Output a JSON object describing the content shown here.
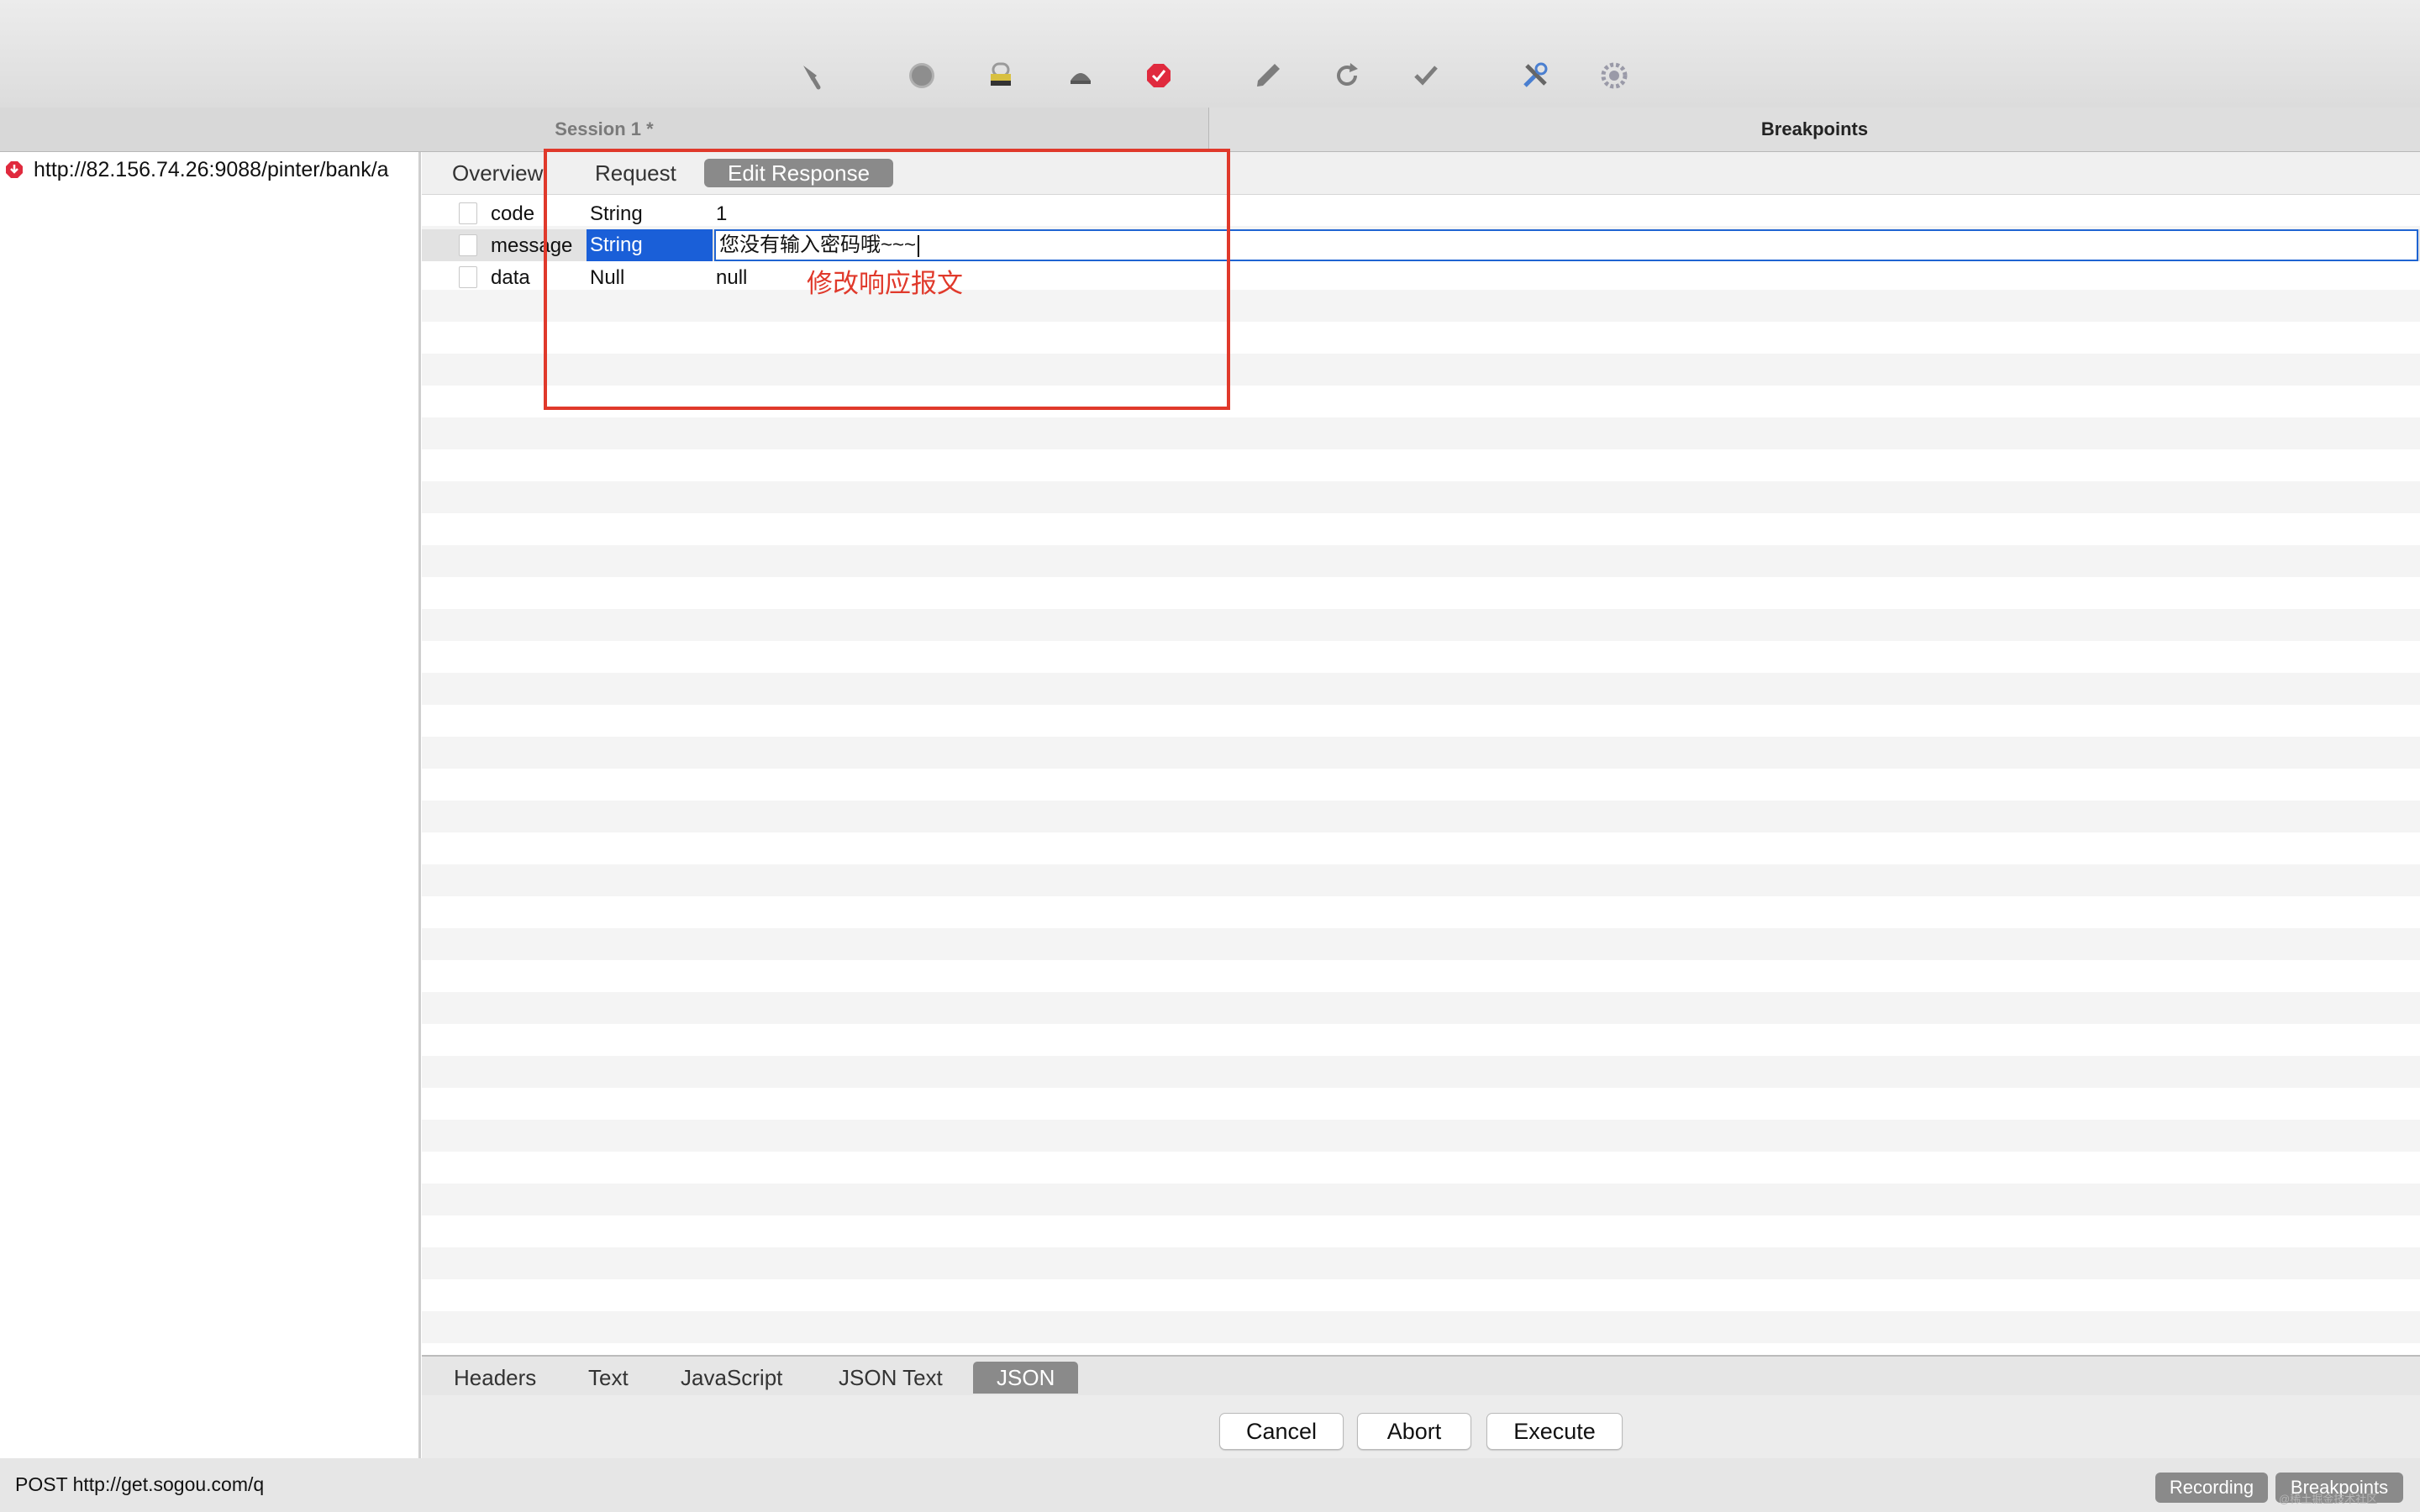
{
  "toolbar": {
    "icons": [
      "broom-icon",
      "record-icon",
      "ssl-lock-icon",
      "throttle-turtle-icon",
      "breakpoint-icon",
      "compose-pen-icon",
      "repeat-icon",
      "validate-check-icon",
      "tools-icon",
      "settings-gear-icon"
    ]
  },
  "session": {
    "tab_title": "Session 1 *",
    "breakpoints_title": "Breakpoints"
  },
  "left": {
    "request_url": "http://82.156.74.26:9088/pinter/bank/a"
  },
  "subtabs": {
    "overview": "Overview",
    "request": "Request",
    "edit_response": "Edit Response"
  },
  "json_rows": [
    {
      "key": "code",
      "type": "String",
      "value": "1"
    },
    {
      "key": "message",
      "type": "String",
      "value": "您没有输入密码哦~~~"
    },
    {
      "key": "data",
      "type": "Null",
      "value": "null"
    }
  ],
  "annotation": {
    "text": "修改响应报文",
    "color": "#e0392b"
  },
  "bottom_tabs": [
    "Headers",
    "Text",
    "JavaScript",
    "JSON Text",
    "JSON"
  ],
  "actions": {
    "cancel": "Cancel",
    "abort": "Abort",
    "execute": "Execute"
  },
  "status": {
    "text": "POST http://get.sogou.com/q",
    "recording": "Recording",
    "breakpoints": "Breakpoints",
    "watermark": "@稀土掘金技术社区"
  },
  "colors": {
    "selection": "#1a5fd8",
    "accent_red": "#e0392b"
  }
}
